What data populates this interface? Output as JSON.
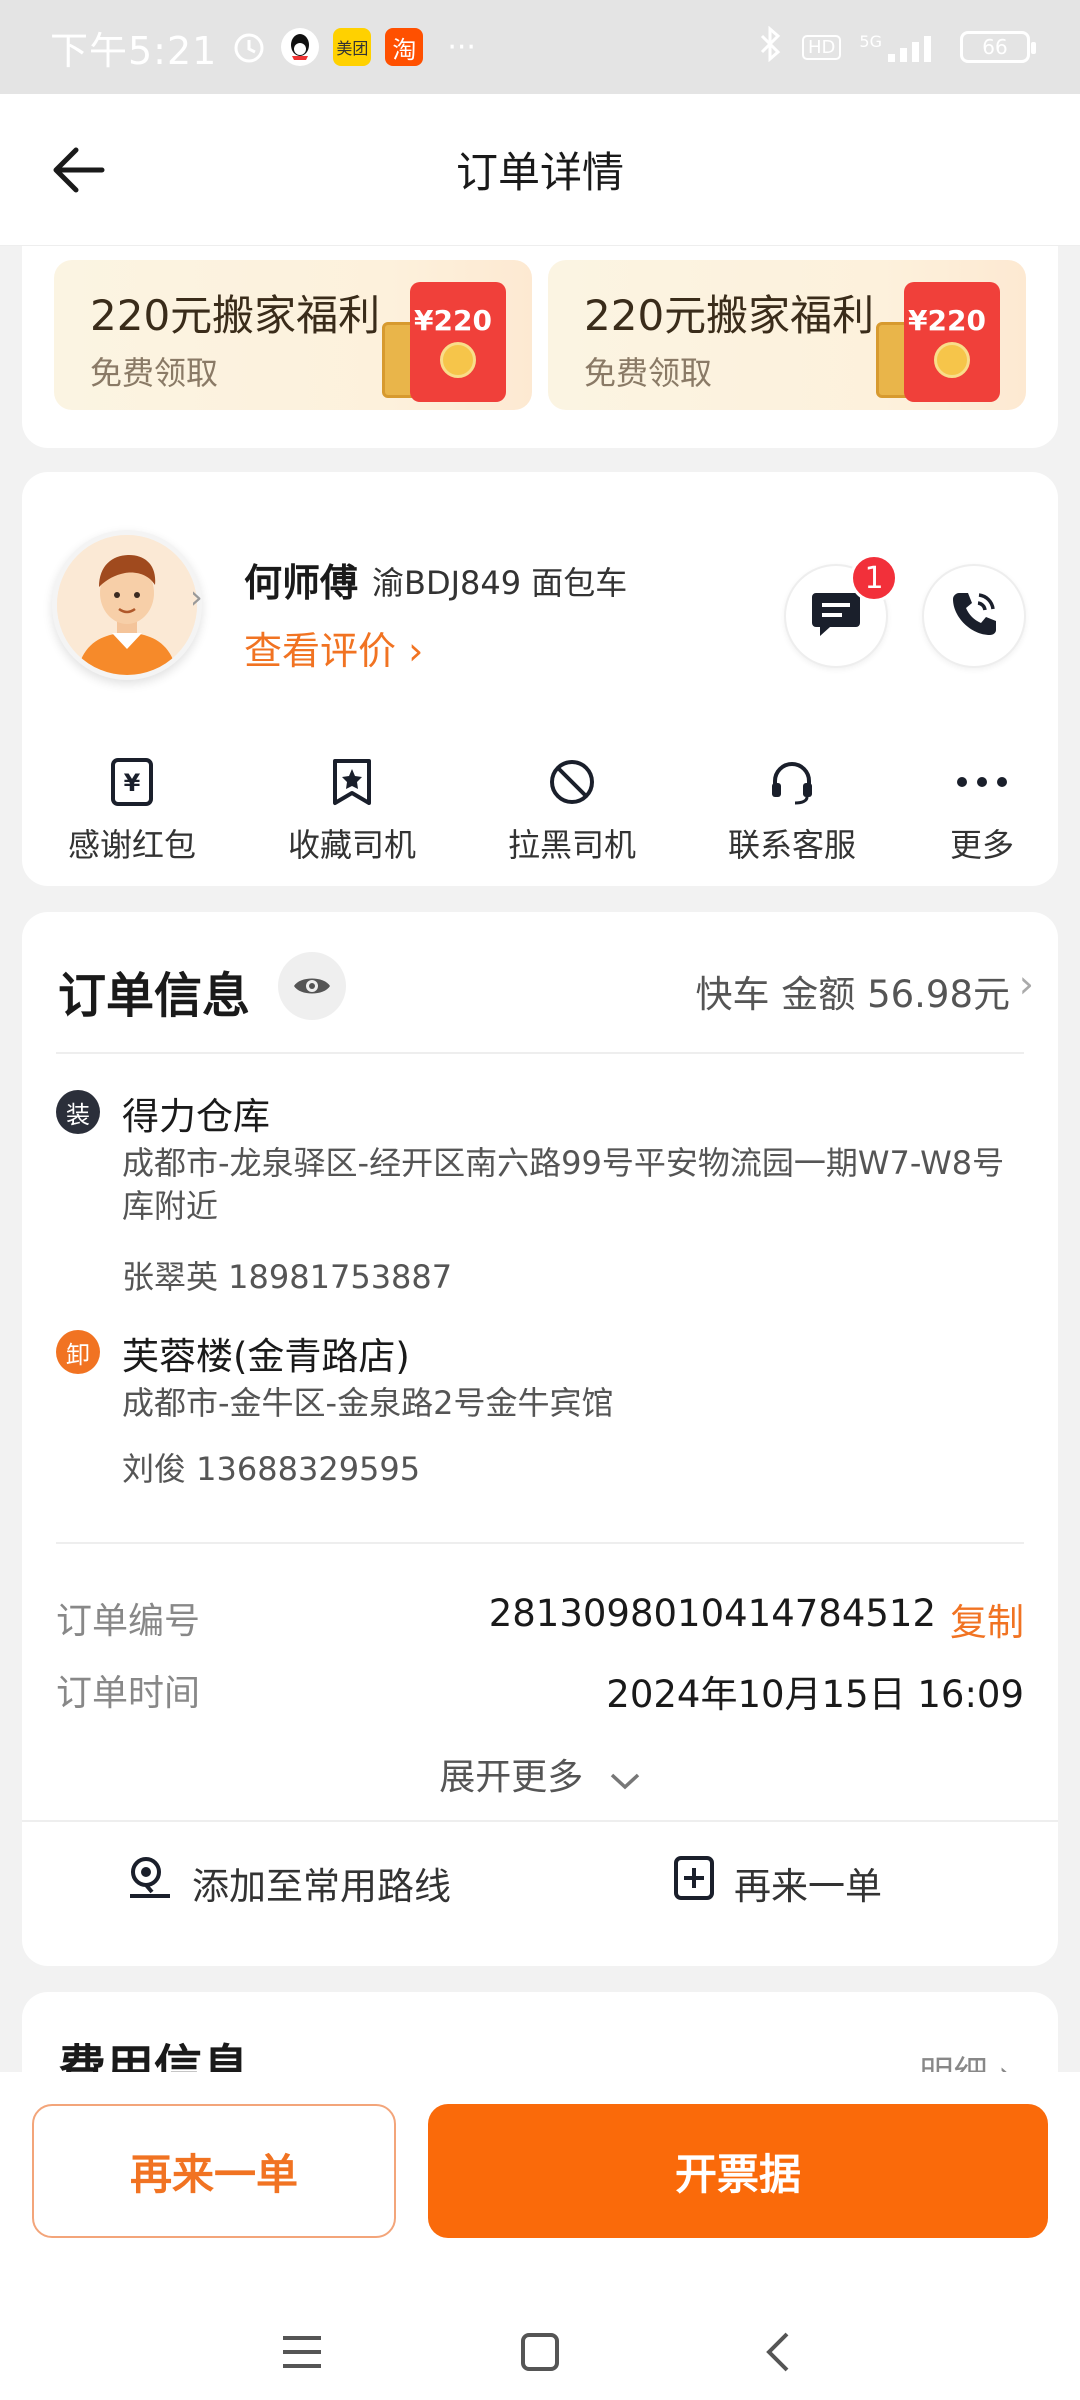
{
  "status_bar": {
    "time": "下午5:21",
    "apps": [
      "alarm-icon",
      "qq-icon",
      "美团",
      "淘"
    ],
    "more": "···",
    "network": "5G",
    "hd": "HD",
    "battery": "66"
  },
  "header": {
    "title": "订单详情"
  },
  "promos": [
    {
      "title": "220元搬家福利",
      "subtitle": "免费领取",
      "amount": "¥220"
    },
    {
      "title": "220元搬家福利",
      "subtitle": "免费领取",
      "amount": "¥220"
    }
  ],
  "driver": {
    "name": "何师傅",
    "plate_vehicle": "渝BDJ849 面包车",
    "review_link": "查看评价 ›",
    "message_badge": "1",
    "actions": [
      {
        "label": "感谢红包",
        "icon": "thanks-redpacket-icon"
      },
      {
        "label": "收藏司机",
        "icon": "favorite-driver-icon"
      },
      {
        "label": "拉黑司机",
        "icon": "block-driver-icon"
      },
      {
        "label": "联系客服",
        "icon": "customer-service-icon"
      },
      {
        "label": "更多",
        "icon": "more-icon"
      }
    ]
  },
  "order": {
    "title": "订单信息",
    "summary": "快车  金额 56.98元",
    "pickup": {
      "tag": "装",
      "name": "得力仓库",
      "address": "成都市-龙泉驿区-经开区南六路99号平安物流园一期W7-W8号库附近",
      "contact": "张翠英 18981753887"
    },
    "dropoff": {
      "tag": "卸",
      "name": "芙蓉楼(金青路店)",
      "address": "成都市-金牛区-金泉路2号金牛宾馆",
      "contact": "刘俊 13688329595"
    },
    "number_label": "订单编号",
    "number_value": "2813098010414784512",
    "copy_label": "复制",
    "time_label": "订单时间",
    "time_value": "2024年10月15日 16:09",
    "expand_label": "展开更多",
    "add_route_label": "添加至常用路线",
    "reorder_label": "再来一单"
  },
  "fee": {
    "title": "费用信息",
    "detail_label": "明细 ›"
  },
  "bottom": {
    "reorder_button": "再来一单",
    "invoice_button": "开票据"
  },
  "colors": {
    "accent": "#fa6a0a",
    "accent_text": "#f17322",
    "badge": "#f2303a",
    "pickup_dot": "#2b2f3a"
  }
}
